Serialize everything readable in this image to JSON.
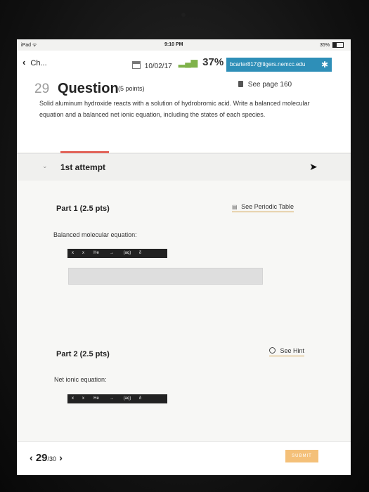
{
  "status_bar": {
    "carrier": "iPad ᯤ",
    "time": "9:10 PM",
    "battery": "35%"
  },
  "nav": {
    "back_label": "Ch...",
    "date": "10/02/17",
    "score": "37%",
    "email": "bcarter817@tigers.nemcc.edu"
  },
  "question": {
    "number": "29",
    "title": "Question",
    "points": "(5 points)",
    "see_page": "See page 160",
    "text": "Solid aluminum hydroxide reacts with a solution of hydrobromic acid. Write a balanced molecular equation and a balanced net ionic equation, including the states of each species."
  },
  "attempt": {
    "label": "1st attempt"
  },
  "part1": {
    "title": "Part 1 (2.5 pts)",
    "link": "See Periodic Table",
    "label": "Balanced molecular equation:"
  },
  "part2": {
    "title": "Part 2 (2.5 pts)",
    "link": "See Hint",
    "label": "Net ionic equation:"
  },
  "toolbar": {
    "subscript": "x",
    "superscript": "x",
    "element": "He",
    "arrow": "→",
    "state": "(aq)",
    "delta": "δ"
  },
  "footer": {
    "current": "29",
    "total": "/30",
    "submit": "SUBMIT"
  },
  "colors": {
    "email_bg": "#2e8fb8",
    "score_icon": "#7fb24a",
    "accent_red": "#e2645a",
    "submit_bg": "#f4c079",
    "link_underline": "#d3a24c"
  }
}
